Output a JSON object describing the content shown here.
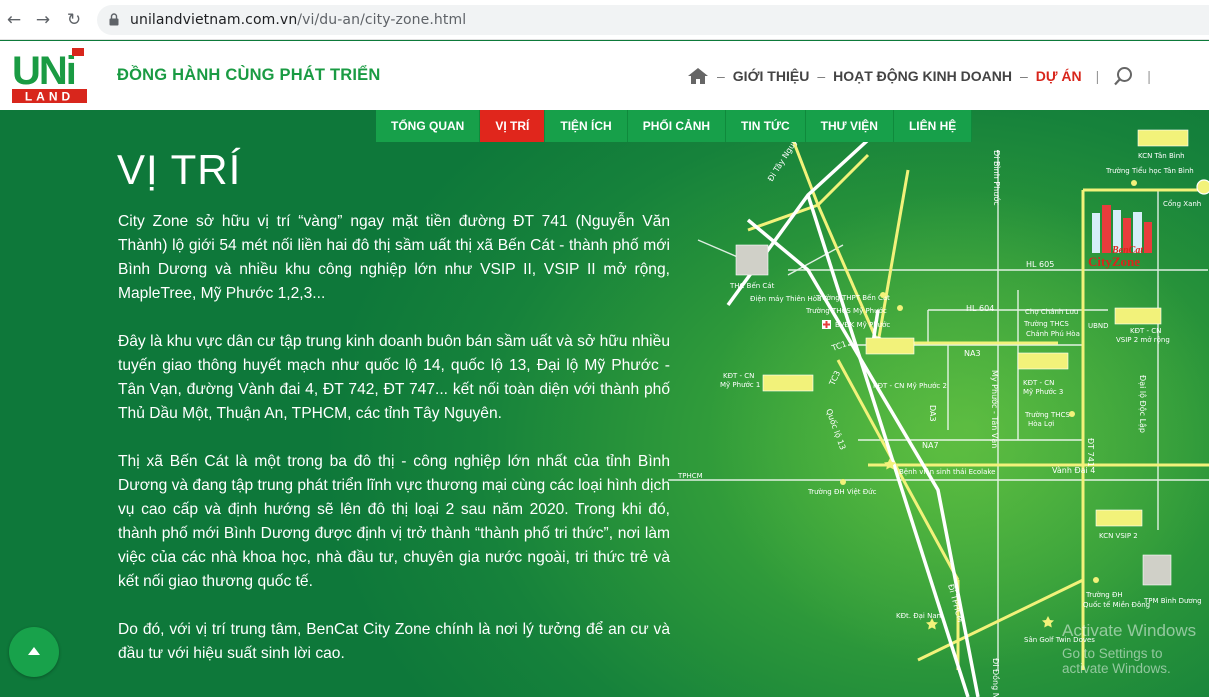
{
  "browser": {
    "url_host": "unilandvietnam.com.vn",
    "url_path": "/vi/du-an/city-zone.html"
  },
  "header": {
    "logo_top": "UNi",
    "logo_bottom": "LAND",
    "tagline": "ĐỒNG HÀNH CÙNG PHÁT TRIỂN",
    "nav": [
      "GIỚI THIỆU",
      "HOẠT ĐỘNG KINH DOANH",
      "DỰ ÁN"
    ],
    "nav_active": "DỰ ÁN",
    "icons": [
      "home-icon",
      "search-icon"
    ]
  },
  "subnav": [
    {
      "label": "TỔNG QUAN",
      "active": false
    },
    {
      "label": "VỊ TRÍ",
      "active": true
    },
    {
      "label": "TIỆN ÍCH",
      "active": false
    },
    {
      "label": "PHỐI CẢNH",
      "active": false
    },
    {
      "label": "TIN TỨC",
      "active": false
    },
    {
      "label": "THƯ VIỆN",
      "active": false
    },
    {
      "label": "LIÊN HỆ",
      "active": false
    }
  ],
  "main": {
    "title": "VỊ TRÍ",
    "paragraphs": [
      "City Zone sở hữu vị trí “vàng” ngay mặt tiền đường ĐT 741 (Nguyễn Văn Thành) lộ giới 54 mét nối liền hai đô thị sầm uất thị xã Bến Cát - thành phố mới Bình Dương và nhiều khu công nghiệp lớn như VSIP II, VSIP II mở rộng, MapleTree, Mỹ Phước 1,2,3...",
      "Đây là khu vực dân cư tập trung kinh doanh buôn bán sầm uất và sở hữu nhiều tuyến giao thông huyết mạch như quốc lộ 14, quốc lộ 13, Đại lộ Mỹ Phước - Tân Vạn, đường Vành đai 4, ĐT 742, ĐT 747... kết nối toàn diện với thành phố Thủ Dầu Một, Thuận An, TPHCM, các tỉnh Tây Nguyên.",
      "Thị xã Bến Cát là một trong ba đô thị - công nghiệp lớn nhất của tỉnh Bình Dương và đang tập trung phát triển lĩnh vực thương mại cùng các loại hình dịch vụ cao cấp và định hướng sẽ lên đô thị loại 2 sau năm 2020. Trong khi đó, thành phố mới Bình Dương được định vị trở thành “thành phố tri thức”, nơi làm việc của các nhà khoa học, nhà đầu tư, chuyên gia nước ngoài, tri thức trẻ và kết nối giao thương quốc tế.",
      "Do đó, với vị trí trung tâm, BenCat City Zone chính là nơi lý tưởng để an cư và đầu tư với hiệu suất sinh lời cao."
    ]
  },
  "map": {
    "project_name_top": "BenCat",
    "project_name": "CityZone",
    "roads": [
      "ĐT Tây Nguyên",
      "ĐT Bình Phước",
      "HL 605",
      "HL 604",
      "NA3",
      "NA7",
      "TC1",
      "TC3",
      "DA3",
      "Quốc lộ 13",
      "Mỹ Phước - Tân Vạn",
      "Vành Đai 4",
      "ĐT 741",
      "Đại lộ Độc Lập",
      "TPHCM",
      "ĐT Tp HCM",
      "Đi Đồng Nai",
      "Đi TPHCM"
    ],
    "places": [
      "KCN Tân Bình",
      "Trường Tiểu học Tân Bình",
      "Cổng Xanh",
      "THC Bến Cát",
      "Điện máy Thiên Hòa",
      "Trường THPT Bến Cát",
      "Trường THCS Mỹ Phước",
      "BVĐK Mỹ Phước",
      "Chợ Chánh Lưu",
      "Trường THCS Chánh Phú Hòa",
      "UBND",
      "KĐT - CN VSIP 2 mở rộng",
      "KĐT - CN Mỹ Phước 1",
      "KĐT - CN Mỹ Phước 2",
      "KĐT - CN Mỹ Phước 3",
      "Trường THCS Hòa Lợi",
      "Bệnh viện Sinh thái Ecolake",
      "Trường ĐH Việt Đức",
      "KCN VSIP 2",
      "Trường ĐH Quốc tế Miền Đông",
      "TPM Bình Dương",
      "KĐt. Đại Nam",
      "Sân Golf Twin Doves"
    ],
    "icons": [
      "building-icon",
      "factory-icon",
      "school-icon",
      "hospital-icon",
      "star-icon"
    ]
  },
  "watermark": {
    "line1": "Activate Windows",
    "line2": "Go to Settings to activate Windows."
  }
}
